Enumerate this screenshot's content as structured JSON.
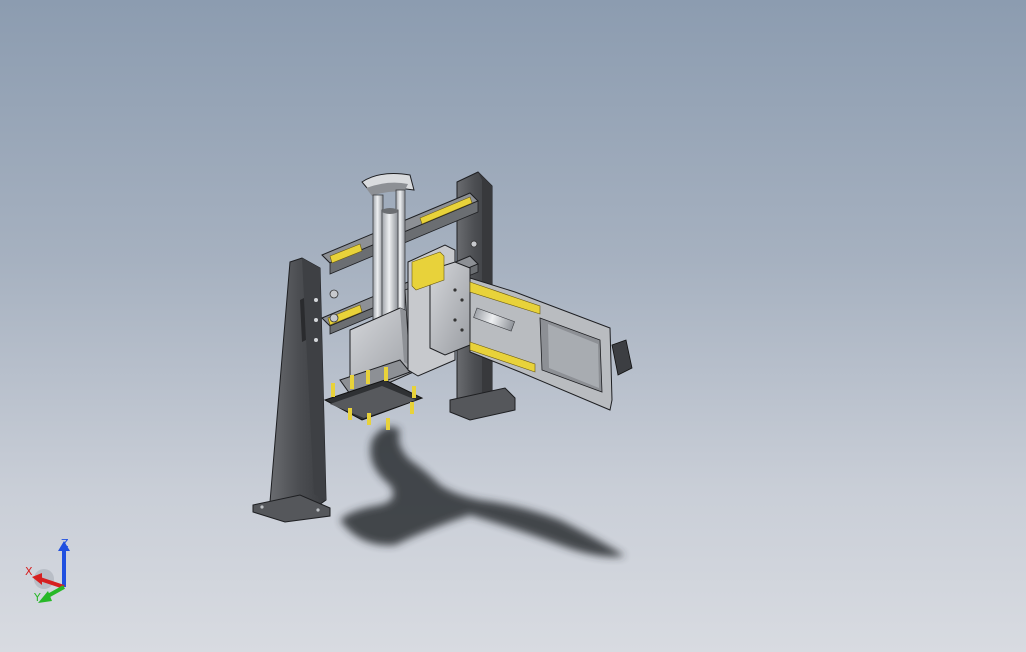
{
  "viewport": {
    "background_top": "#8c9cb0",
    "background_bottom": "#d8dbe1"
  },
  "model": {
    "frame_color": "#5b5d60",
    "plate_color": "#b9bcc0",
    "rail_accent": "#e8d23a",
    "shadow_color": "#2b2d31"
  },
  "triad": {
    "x_label": "X",
    "y_label": "Y",
    "z_label": "Z",
    "x_color": "#d62020",
    "y_color": "#28b828",
    "z_color": "#2050e0"
  }
}
